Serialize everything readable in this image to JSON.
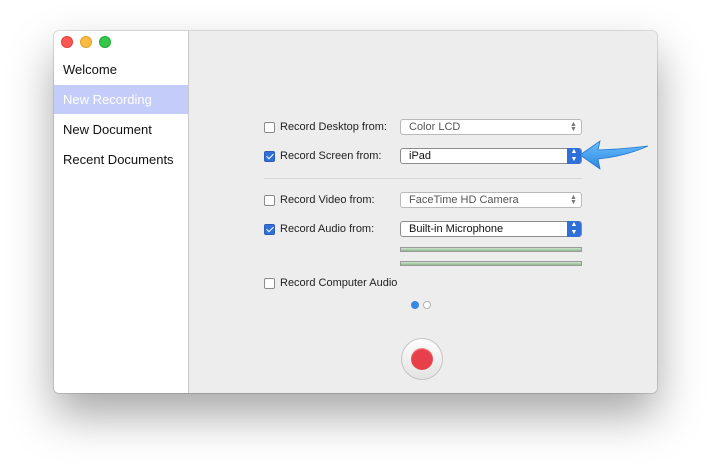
{
  "window": {
    "controls": [
      "close",
      "minimize",
      "zoom"
    ]
  },
  "sidebar": {
    "items": [
      {
        "label": "Welcome",
        "active": false
      },
      {
        "label": "New Recording",
        "active": true
      },
      {
        "label": "New Document",
        "active": false
      },
      {
        "label": "Recent Documents",
        "active": false
      }
    ]
  },
  "options": {
    "desktop": {
      "label": "Record Desktop from:",
      "checked": false,
      "value": "Color LCD"
    },
    "screen": {
      "label": "Record Screen from:",
      "checked": true,
      "value": "iPad"
    },
    "video": {
      "label": "Record Video from:",
      "checked": false,
      "value": "FaceTime HD Camera"
    },
    "audio": {
      "label": "Record Audio from:",
      "checked": true,
      "value": "Built-in Microphone"
    },
    "computer_audio": {
      "label": "Record Computer Audio",
      "checked": false
    }
  },
  "audio_levels": [
    0.0,
    0.0
  ],
  "pager": {
    "current": 1,
    "total": 2
  },
  "colors": {
    "accent": "#2f6fd8",
    "selection": "#c4cdfa",
    "record": "#e8404a",
    "callout_arrow": "#3a9af0"
  },
  "icons": {
    "record_button": "record-icon",
    "popup_arrows": "updown-chevron-icon",
    "callout": "arrow-left-icon"
  }
}
